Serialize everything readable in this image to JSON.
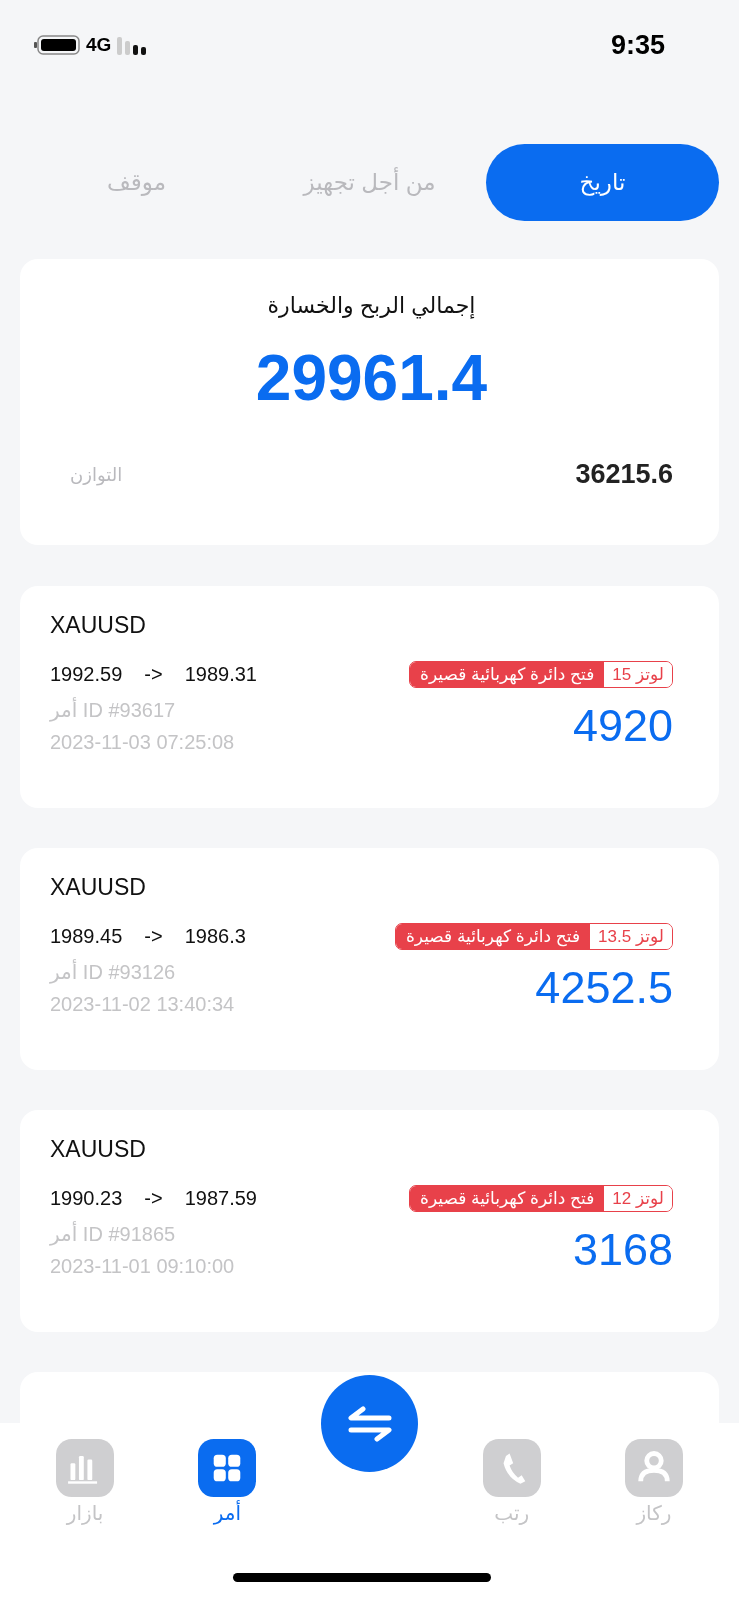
{
  "status_bar": {
    "network": "4G",
    "time": "9:35"
  },
  "tabs": [
    {
      "label": "تاريخ",
      "selected": true
    },
    {
      "label": "من أجل تجهيز",
      "selected": false
    },
    {
      "label": "موقف",
      "selected": false
    }
  ],
  "summary": {
    "title": "إجمالي الربح والخسارة",
    "total": "29961.4",
    "balance_label": "التوازن",
    "balance": "36215.6"
  },
  "orders": [
    {
      "symbol": "XAUUSD",
      "open_price": "1992.59",
      "arrow": "->",
      "close_price": "1989.31",
      "direction": "فتح دائرة كهربائية قصيرة",
      "lots": "لوتز 15",
      "order_id": "أمر ID #93617",
      "time": "2023-11-03 07:25:08",
      "profit": "4920"
    },
    {
      "symbol": "XAUUSD",
      "open_price": "1989.45",
      "arrow": "->",
      "close_price": "1986.3",
      "direction": "فتح دائرة كهربائية قصيرة",
      "lots": "لوتز 13.5",
      "order_id": "أمر ID #93126",
      "time": "2023-11-02 13:40:34",
      "profit": "4252.5"
    },
    {
      "symbol": "XAUUSD",
      "open_price": "1990.23",
      "arrow": "->",
      "close_price": "1987.59",
      "direction": "فتح دائرة كهربائية قصيرة",
      "lots": "لوتز 12",
      "order_id": "أمر ID #91865",
      "time": "2023-11-01 09:10:00",
      "profit": "3168"
    }
  ],
  "bottom_nav": [
    {
      "kind": "tab",
      "label": "ركاز",
      "selected": false
    },
    {
      "kind": "tab",
      "label": "رتب",
      "selected": false
    },
    {
      "kind": "action"
    },
    {
      "kind": "tab",
      "label": "أمر",
      "selected": true
    },
    {
      "kind": "tab",
      "label": "بازار",
      "selected": false
    }
  ]
}
